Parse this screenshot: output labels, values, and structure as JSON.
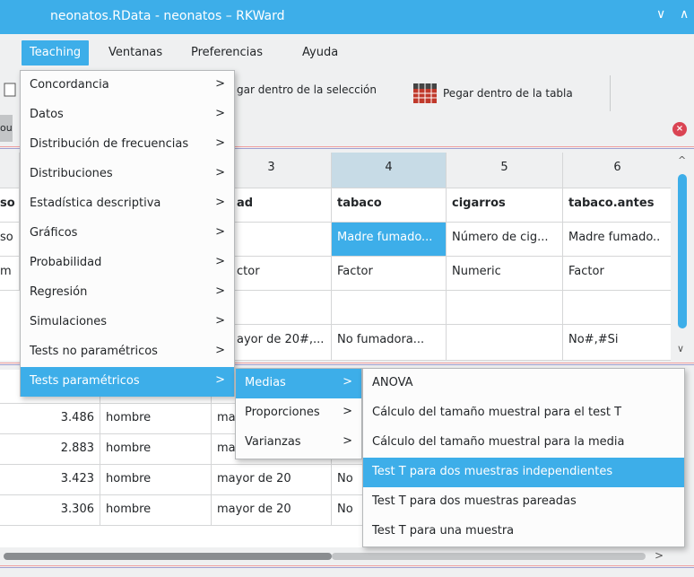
{
  "window": {
    "title": "neonatos.RData - neonatos – RKWard",
    "minimize_glyph": "∨",
    "maximize_glyph": "∧"
  },
  "menubar": [
    {
      "label": "Teaching",
      "active": true
    },
    {
      "label": "Ventanas"
    },
    {
      "label": "Preferencias"
    },
    {
      "label": "Ayuda"
    }
  ],
  "toolbar": {
    "paste_selection": "gar dentro de la selección",
    "paste_table": "Pegar dentro de la tabla",
    "tab_fragment": "ou"
  },
  "grid_upper": {
    "headers": [
      "3",
      "4",
      "5",
      "6"
    ],
    "left_fragments": [
      "so",
      "so",
      "m",
      "",
      ""
    ],
    "rows": [
      [
        "ad",
        "tabaco",
        "cigarros",
        "tabaco.antes"
      ],
      [
        "",
        "Madre fumado...",
        "Número de cig...",
        "Madre fumado.."
      ],
      [
        "ctor",
        "Factor",
        "Numeric",
        "Factor"
      ],
      [
        "",
        "",
        "",
        ""
      ],
      [
        "ayor de 20#,...",
        "No fumadora...",
        "",
        "No#,#Si"
      ]
    ]
  },
  "grid_lower": {
    "rows": [
      [
        "3.486",
        "hombre",
        "ma",
        ""
      ],
      [
        "2.883",
        "hombre",
        "mayor de 20",
        "No"
      ],
      [
        "3.423",
        "hombre",
        "mayor de 20",
        "No"
      ],
      [
        "3.306",
        "hombre",
        "mayor de 20",
        "No"
      ]
    ]
  },
  "menu_teaching": [
    {
      "label": "Concordancia"
    },
    {
      "label": "Datos"
    },
    {
      "label": "Distribución de frecuencias"
    },
    {
      "label": "Distribuciones"
    },
    {
      "label": "Estadística descriptiva"
    },
    {
      "label": "Gráficos"
    },
    {
      "label": "Probabilidad"
    },
    {
      "label": "Regresión"
    },
    {
      "label": "Simulaciones"
    },
    {
      "label": "Tests no paramétricos"
    },
    {
      "label": "Tests paramétricos",
      "active": true
    }
  ],
  "menu_parametric": [
    {
      "label": "Medias",
      "active": true
    },
    {
      "label": "Proporciones"
    },
    {
      "label": "Varianzas"
    }
  ],
  "menu_medias": [
    {
      "label": "ANOVA"
    },
    {
      "label": "Cálculo del tamaño muestral para el test T"
    },
    {
      "label": "Cálculo del tamaño muestral para la media"
    },
    {
      "label": "Test T para dos muestras independientes",
      "active": true
    },
    {
      "label": "Test T para dos muestras pareadas"
    },
    {
      "label": "Test T para una muestra"
    }
  ],
  "submenu_arrow": ">",
  "scroll_arrow_right": ">",
  "scroll_arrow_up": "^",
  "scroll_arrow_down": "∨",
  "close_glyph": "×",
  "colors": {
    "accent": "#3daee9",
    "close": "#da4453"
  }
}
